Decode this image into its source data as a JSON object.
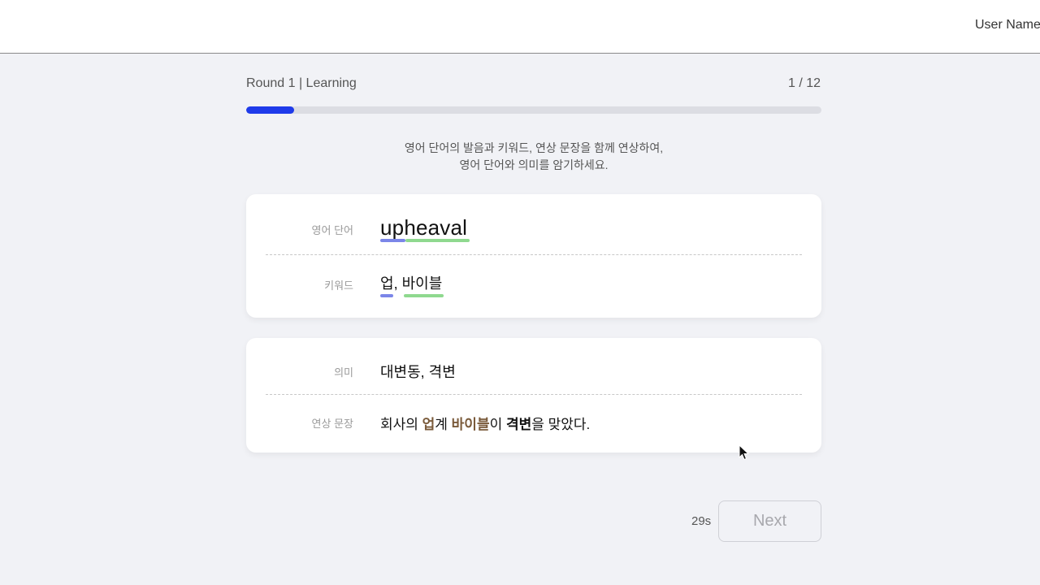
{
  "header": {
    "user_name": "User Name"
  },
  "round": {
    "label": "Round 1 | Learning",
    "counter": "1 / 12",
    "progress_fraction": 0.0833
  },
  "instructions": {
    "line1": "영어 단어의 발음과 키워드, 연상 문장을 함께 연상하여,",
    "line2": "영어 단어와 의미를 암기하세요."
  },
  "card_word": {
    "word_label": "영어 단어",
    "word": "upheaval",
    "keyword_label": "키워드",
    "keyword_1": "업",
    "keyword_separator": ",",
    "keyword_2": "바이블"
  },
  "card_meaning": {
    "meaning_label": "의미",
    "meaning": "대변동, 격변",
    "sentence_label": "연상 문장",
    "sentence_parts": {
      "p1": "회사의 ",
      "h1": "업",
      "p2": "계 ",
      "h2": "바이블",
      "p3": "이 ",
      "b1": "격변",
      "p4": "을 맞았다."
    }
  },
  "footer": {
    "timer": "29s",
    "next_label": "Next"
  },
  "colors": {
    "accent_blue": "#1f3bea",
    "keyword1_underline": "#7b86e8",
    "keyword2_underline": "#8fd98f",
    "highlight_text": "#7a5a3a"
  }
}
